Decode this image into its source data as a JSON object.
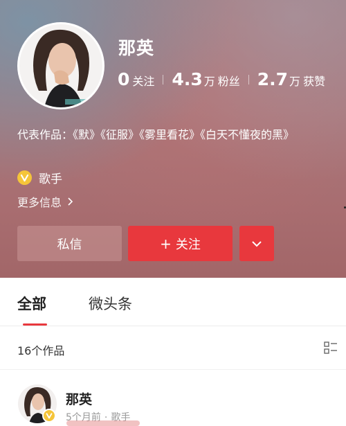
{
  "profile": {
    "nickname": "那英",
    "stats": [
      {
        "value": "0",
        "unit": "",
        "label": "关注"
      },
      {
        "value": "4.3",
        "unit": "万",
        "label": "粉丝"
      },
      {
        "value": "2.7",
        "unit": "万",
        "label": "获赞"
      }
    ],
    "works_label": "代表作品：",
    "works_list": "《默》《征服》《雾里看花》《白天不懂夜的黑》",
    "certification": "歌手",
    "more_info": "更多信息"
  },
  "actions": {
    "message": "私信",
    "follow": "关注",
    "follow_plus": "+"
  },
  "tabs": [
    {
      "label": "全部",
      "active": true
    },
    {
      "label": "微头条",
      "active": false
    }
  ],
  "works_count": "16个作品",
  "feed": [
    {
      "author": "那英",
      "time": "5个月前",
      "dot": "·",
      "tag": "歌手"
    }
  ],
  "icons": {
    "verified": "verified-v-icon",
    "more_chevron": "chevron-right-icon",
    "dropdown": "chevron-down-icon",
    "list_view": "list-view-icon"
  },
  "colors": {
    "accent": "#e8383d",
    "verified": "#f5c53a"
  }
}
